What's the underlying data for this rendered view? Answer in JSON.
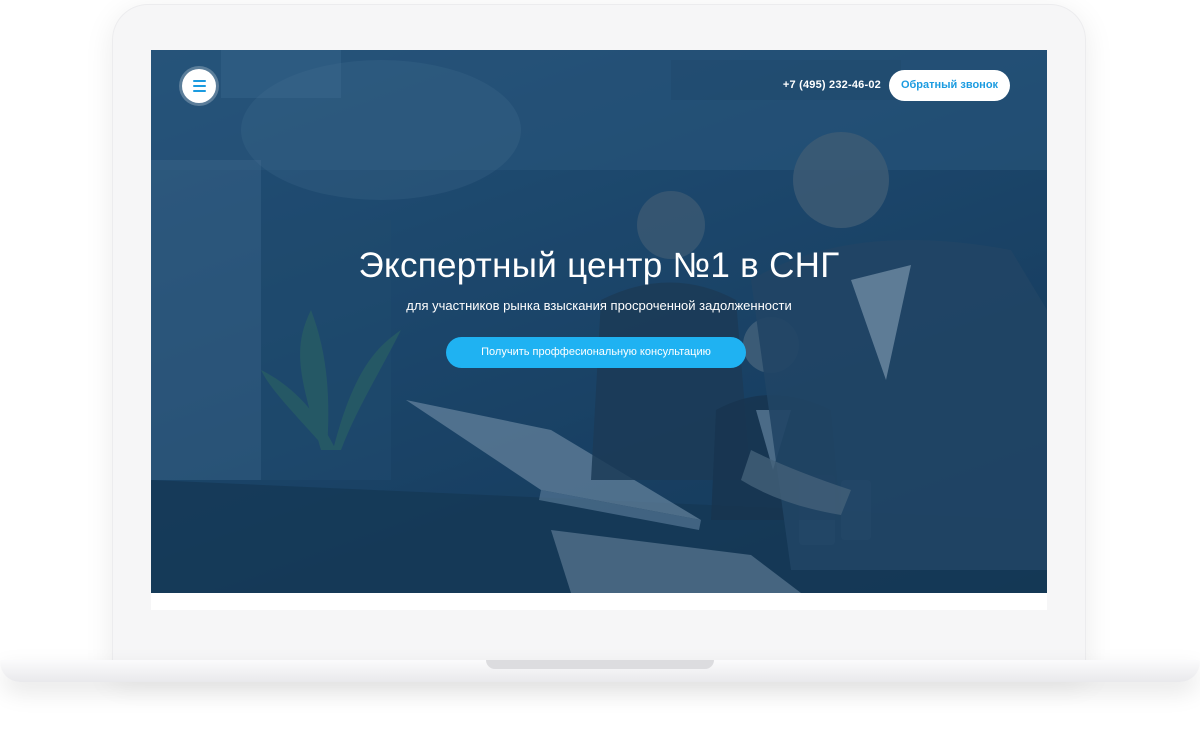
{
  "header": {
    "menu_icon": "hamburger-menu-icon",
    "phone": "+7 (495) 232-46-02",
    "callback_label": "Обратный звонок"
  },
  "hero": {
    "title": "Экспертный центр №1 в СНГ",
    "subtitle": "для участников рынка взыскания просроченной задолженности",
    "cta_label": "Получить проффесиональную консультацию"
  },
  "colors": {
    "accent": "#1fb2f2",
    "accent_text": "#1b9be0",
    "overlay": "#1c4a72",
    "frame": "#f6f6f7"
  }
}
